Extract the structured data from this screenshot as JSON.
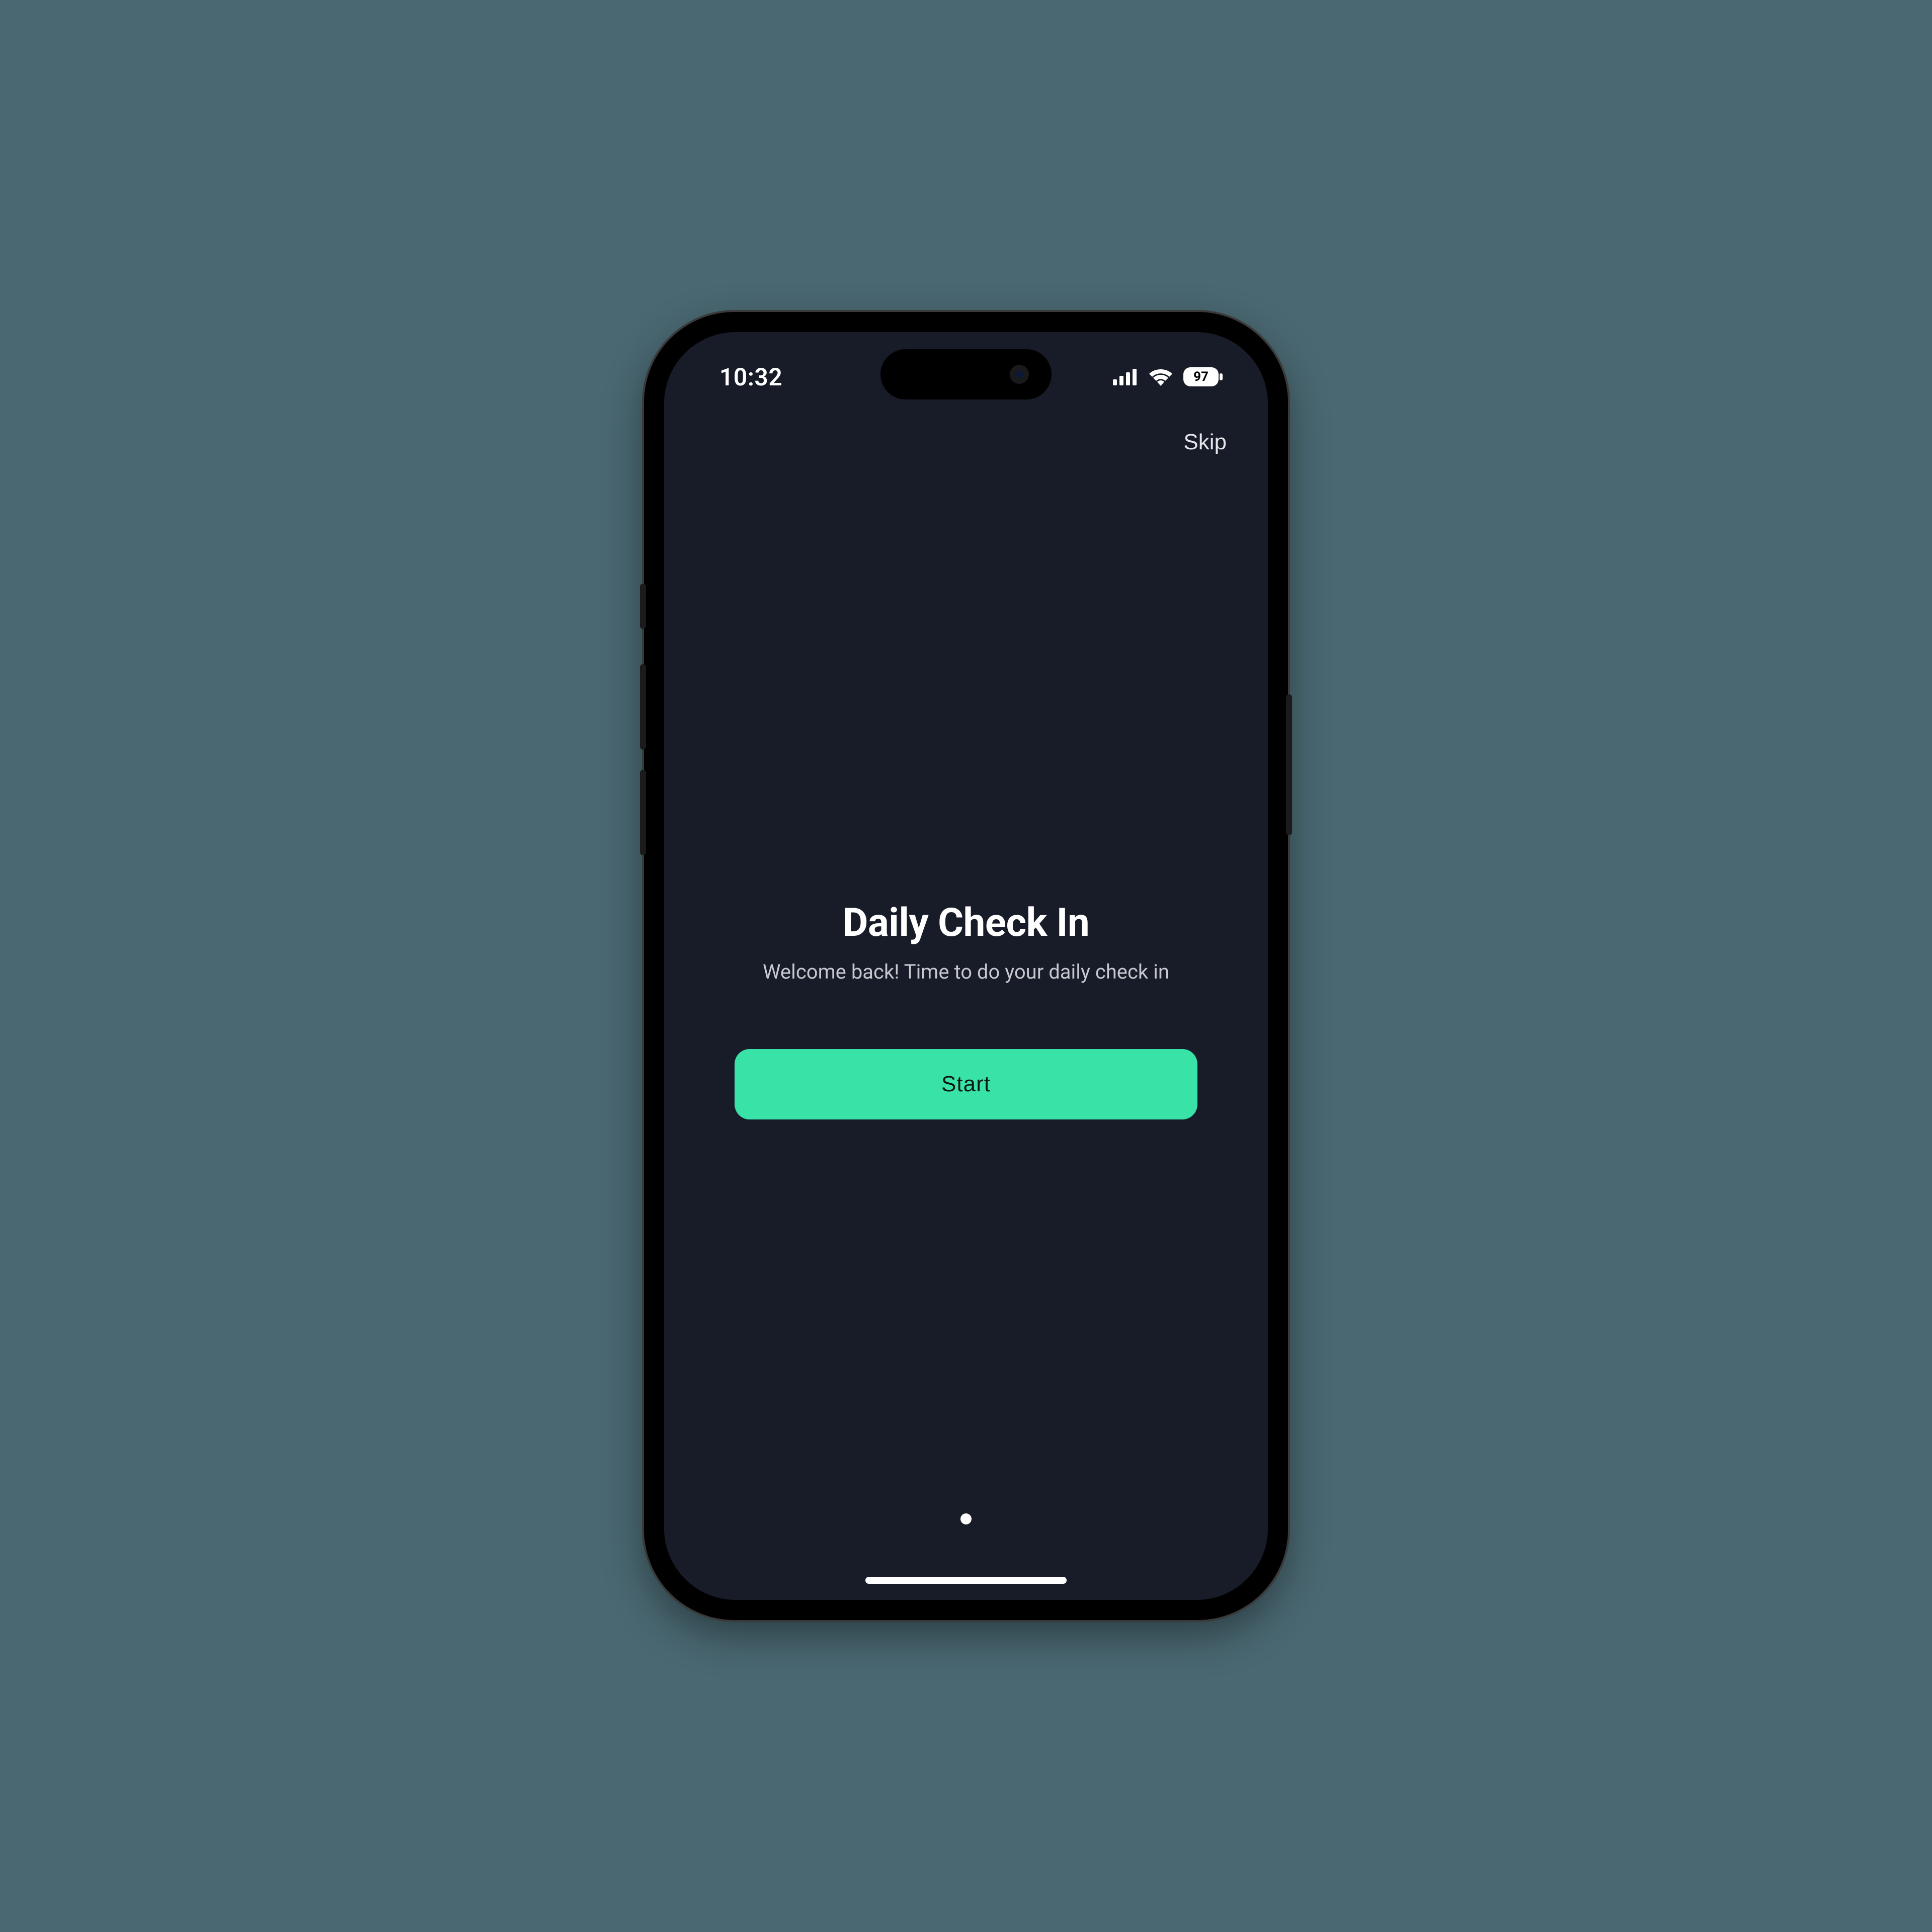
{
  "status": {
    "time": "10:32",
    "battery": "97"
  },
  "nav": {
    "skip_label": "Skip"
  },
  "main": {
    "title": "Daily Check In",
    "subtitle": "Welcome back! Time to do your daily check in",
    "start_label": "Start"
  }
}
